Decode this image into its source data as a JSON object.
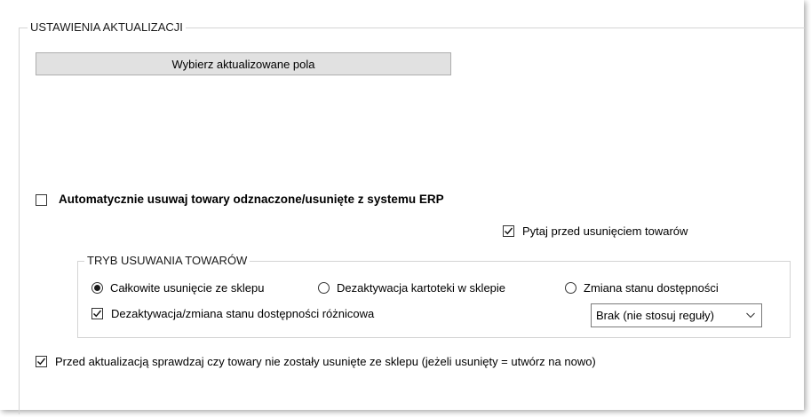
{
  "settings_group": {
    "title": "USTAWIENIA AKTUALIZACJI",
    "select_fields_button": "Wybierz aktualizowane pola"
  },
  "auto_delete": {
    "label": "Automatycznie usuwaj towary odznaczone/usunięte z systemu ERP",
    "checked": false
  },
  "ask_before_delete": {
    "label": "Pytaj przed usunięciem towarów",
    "checked": true
  },
  "delete_mode_group": {
    "title": "TRYB USUWANIA TOWARÓW",
    "options": [
      {
        "label": "Całkowite usunięcie ze sklepu",
        "selected": true
      },
      {
        "label": "Dezaktywacja kartoteki w sklepie",
        "selected": false
      },
      {
        "label": "Zmiana stanu dostępności",
        "selected": false
      }
    ],
    "differential": {
      "label": "Dezaktywacja/zmiana stanu dostępności różnicowa",
      "checked": true
    },
    "rule_select": {
      "value": "Brak (nie stosuj reguły)"
    }
  },
  "check_removed": {
    "label": "Przed aktualizacją sprawdzaj czy towary nie zostały usunięte ze sklepu (jeżeli usunięty = utwórz na nowo)",
    "checked": true
  }
}
